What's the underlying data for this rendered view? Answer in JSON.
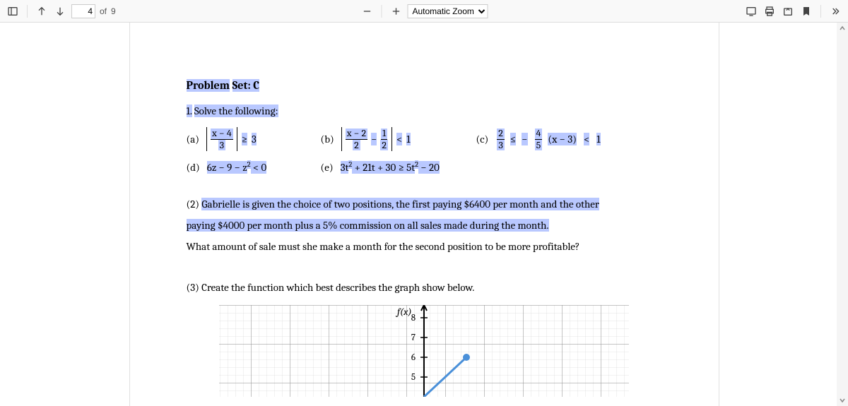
{
  "toolbar": {
    "page_current": "4",
    "page_label_of": "of",
    "page_total": "9",
    "zoom_value": "Automatic Zoom"
  },
  "doc": {
    "problem_set_label_a": "Problem",
    "problem_set_label_b": "Set: C",
    "q1_num": "1.",
    "q1_text": "Solve the following:",
    "a": {
      "label": "(a)",
      "num": "x − 4",
      "den": "3",
      "op": "≥",
      "rhs": "3"
    },
    "b": {
      "label": "(b)",
      "num1": "x − 2",
      "den1": "2",
      "minus": "−",
      "num2": "1",
      "den2": "2",
      "op": "<",
      "rhs": "1"
    },
    "c": {
      "label": "(c)",
      "num1": "2",
      "den1": "3",
      "op1": "≤",
      "minus": "−",
      "num2": "4",
      "den2": "5",
      "paren": "(x − 3)",
      "op2": "<",
      "rhs": "1"
    },
    "d": {
      "label": "(d)",
      "expr": "6z − 9 − z",
      "sup": "2",
      "tail": " < 0"
    },
    "e": {
      "label": "(e)",
      "lhs_a": "3t",
      "sup1": "2",
      "lhs_b": " + 21t + 30 ≥ 5t",
      "sup2": "2",
      "rhs": " − 20"
    },
    "q2_num": "(2)",
    "q2_line1_a": "Gabrielle is given the choice of two positions, the first paying $6400 per month and the other",
    "q2_line2_a": "paying $4000 per month plus a 5% commission on all sales made during the month.",
    "q2_line3": "What amount of sale must she make a month for the second position to be more profitable?",
    "q3": "(3) Create the function which best describes the graph show below.",
    "graph_fx": "f(x)",
    "y_ticks": [
      "8",
      "7",
      "6",
      "5"
    ]
  }
}
